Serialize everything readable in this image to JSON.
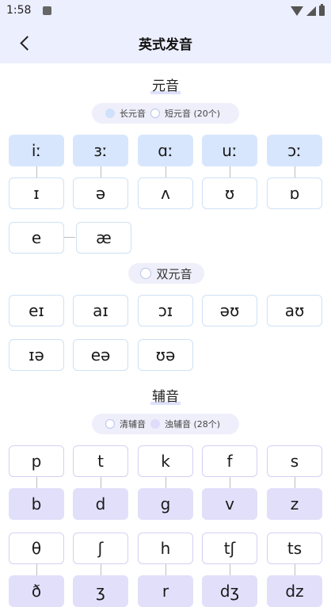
{
  "status_bar": {
    "time": "1:58"
  },
  "header": {
    "title": "英式发音"
  },
  "vowels": {
    "title": "元音",
    "legend": {
      "long_label": "长元音",
      "short_label": "短元音 (20个)"
    },
    "long": [
      "iː",
      "ɜː",
      "ɑː",
      "uː",
      "ɔː"
    ],
    "short": [
      "ɪ",
      "ə",
      "ʌ",
      "ʊ",
      "ɒ"
    ],
    "extra": [
      "e",
      "æ"
    ]
  },
  "diphthongs": {
    "label": "双元音",
    "row1": [
      "eɪ",
      "aɪ",
      "ɔɪ",
      "əʊ",
      "aʊ"
    ],
    "row2": [
      "ɪə",
      "eə",
      "ʊə"
    ]
  },
  "consonants": {
    "title": "辅音",
    "legend": {
      "voiceless_label": "清辅音",
      "voiced_label": "浊辅音 (28个)"
    },
    "row1_voiceless": [
      "p",
      "t",
      "k",
      "f",
      "s"
    ],
    "row1_voiced": [
      "b",
      "d",
      "g",
      "v",
      "z"
    ],
    "row2_voiceless": [
      "θ",
      "ʃ",
      "h",
      "tʃ",
      "ts"
    ],
    "row2_voiced": [
      "ð",
      "ʒ",
      "r",
      "dʒ",
      "dz"
    ]
  }
}
